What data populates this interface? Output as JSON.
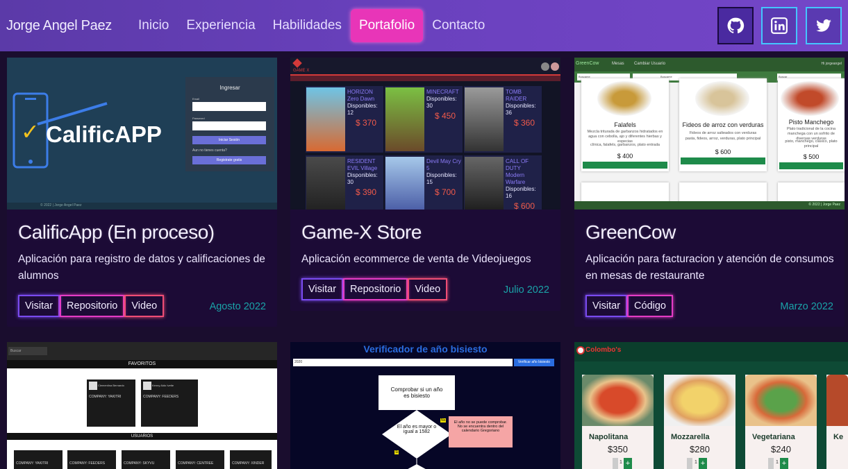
{
  "navbar": {
    "brand": "Jorge Angel Paez",
    "links": [
      "Inicio",
      "Experiencia",
      "Habilidades",
      "Portafolio",
      "Contacto"
    ],
    "active": "Portafolio",
    "social": [
      "github-icon",
      "linkedin-icon",
      "twitter-icon"
    ]
  },
  "projects": [
    {
      "title": "CalificApp (En proceso)",
      "description": "Aplicación para registro de datos y calificaciones de alumnos",
      "buttons": [
        "Visitar",
        "Repositorio",
        "Video"
      ],
      "date": "Agosto 2022",
      "thumb": {
        "app_name": "CalificAPP",
        "login_title": "Ingresar",
        "email_label": "Email",
        "password_label": "Password",
        "login_button": "Iniciar Sesión",
        "no_account": "Aun no tienes cuenta?",
        "register_button": "Registrate gratis",
        "footer": "© 2022 | Jorge Angel Paez"
      }
    },
    {
      "title": "Game-X Store",
      "description": "Aplicación ecommerce de venta de Videojuegos",
      "buttons": [
        "Visitar",
        "Repositorio",
        "Video"
      ],
      "date": "Julio 2022",
      "thumb": {
        "logo": "GAME X",
        "games": [
          {
            "name": "HORIZON Zero Dawn",
            "stock": "Disponibles: 12",
            "price": "$ 370"
          },
          {
            "name": "MINECRAFT",
            "stock": "Disponibles: 30",
            "price": "$ 450"
          },
          {
            "name": "TOMB RAIDER",
            "stock": "Disponibles: 36",
            "price": "$ 360"
          },
          {
            "name": "RESIDENT EVIL Village",
            "stock": "Disponibles: 30",
            "price": "$ 390"
          },
          {
            "name": "Devil May Cry 5",
            "stock": "Disponibles: 15",
            "price": "$ 700"
          },
          {
            "name": "CALL OF DUTY Modern Warfare",
            "stock": "Disponibles: 16",
            "price": "$ 600"
          }
        ]
      }
    },
    {
      "title": "GreenCow",
      "description": "Aplicación para facturacion y atención de consumos en mesas de restaurante",
      "buttons": [
        "Visitar",
        "Código"
      ],
      "date": "Marzo 2022",
      "thumb": {
        "brand": "GreenCow",
        "menu1": "Mesas",
        "menu2": "Cambiar Usuario",
        "user": "Hi jorgeangel",
        "filter1": "Buscame",
        "filter2": "Buscar",
        "dishes": [
          {
            "name": "Falafels",
            "desc": "Mezcla triturada de garbanzos hidratados en agua con cebolla, ajo y diferentes hierbas y especias",
            "tags": "clínica, falafels, garbanzos, plato entrada",
            "price": "$ 400"
          },
          {
            "name": "Fideos de arroz con verduras",
            "desc": "Fideos de arroz salteados con verduras",
            "tags": "pasta, fideos, arroz, verduras, plato principal",
            "price": "$ 600"
          },
          {
            "name": "Pisto Manchego",
            "desc": "Plato tradicional de la cocina manchega con un sofrito de diversas verduras",
            "tags": "pisto, manchego, clásico, plato principal",
            "price": "$ 500"
          }
        ],
        "footer": "© 2022 | Jorge Paez"
      }
    },
    {
      "thumb": {
        "search_placeholder": "Buscar",
        "favorites": "FAVORITOS",
        "users": "USUARIOS",
        "fav_users": [
          {
            "name": "Clementina Bernardo",
            "company": "COMPANY: YAKITRI"
          },
          {
            "name": "Kenny Aldo Ivette",
            "company": "COMPANY: FEEDERS"
          }
        ],
        "company_labels": [
          "COMPANY: YAKITRI",
          "COMPANY: FEEDERS",
          "COMPANY: SKYVU",
          "COMPANY: CENTREE",
          "COMPANY: XINDER"
        ]
      }
    },
    {
      "thumb": {
        "title": "Verificador de año bisiesto",
        "input_value": "2020",
        "verify_button": "Verificar año bisiesto",
        "step1": "Comprobar si un año es bisiesto",
        "step2": "El año es mayor o igual a 1582",
        "no": "No",
        "step_no": "El año no se puede comprobar. No se encuentra dentro del calendario Gregoriano",
        "si": "Si"
      }
    },
    {
      "thumb": {
        "brand": "Colombo's",
        "pizzas": [
          {
            "name": "Napolitana",
            "price": "$350"
          },
          {
            "name": "Mozzarella",
            "price": "$280"
          },
          {
            "name": "Vegetariana",
            "price": "$240"
          },
          {
            "name": "Ke"
          }
        ],
        "qty": "1"
      }
    }
  ],
  "colors": {
    "nav": "#6a41be",
    "active": "#e835b8",
    "card": "#1c0b36",
    "date": "#1aa3a8"
  }
}
